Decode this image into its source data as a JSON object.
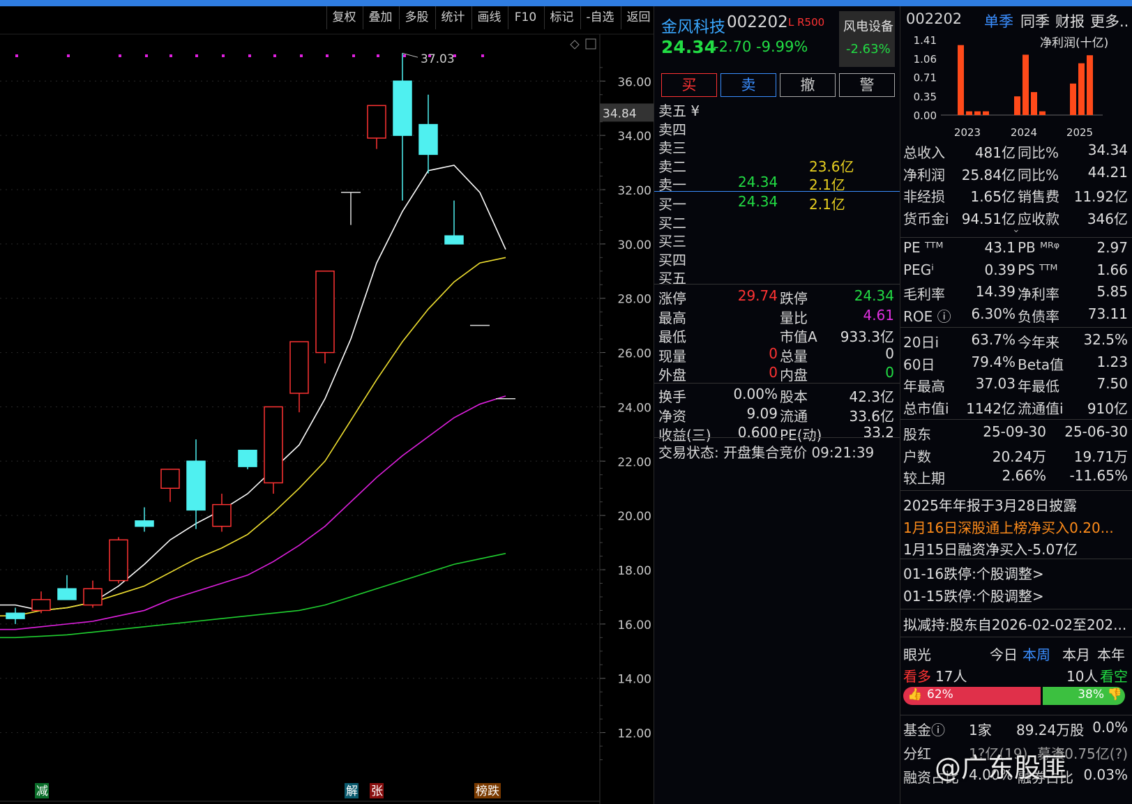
{
  "toolbar": {
    "items": [
      "复权",
      "叠加",
      "多股",
      "统计",
      "画线",
      "F10",
      "标记",
      "-自选",
      "返回"
    ]
  },
  "chart_data": {
    "type": "candlestick",
    "yaxis_ticks": [
      "36.00",
      "34.00",
      "32.00",
      "30.00",
      "28.00",
      "26.00",
      "24.00",
      "22.00",
      "20.00",
      "18.00",
      "16.00",
      "14.00",
      "12.00"
    ],
    "ylim": [
      10.5,
      37.6
    ],
    "current_price_label": "34.84",
    "high_annotation": "37.03",
    "candles": [
      {
        "o": 16.2,
        "h": 16.6,
        "l": 16.0,
        "c": 16.4,
        "d": "down"
      },
      {
        "o": 16.5,
        "h": 17.2,
        "l": 16.4,
        "c": 16.9,
        "d": "up"
      },
      {
        "o": 17.3,
        "h": 17.8,
        "l": 16.9,
        "c": 16.9,
        "d": "down"
      },
      {
        "o": 16.7,
        "h": 17.6,
        "l": 16.6,
        "c": 17.3,
        "d": "up"
      },
      {
        "o": 17.6,
        "h": 19.2,
        "l": 17.5,
        "c": 19.1,
        "d": "up"
      },
      {
        "o": 19.8,
        "h": 20.3,
        "l": 19.4,
        "c": 19.6,
        "d": "down"
      },
      {
        "o": 21.0,
        "h": 21.7,
        "l": 20.5,
        "c": 21.7,
        "d": "up"
      },
      {
        "o": 22.0,
        "h": 22.8,
        "l": 19.5,
        "c": 20.2,
        "d": "down"
      },
      {
        "o": 19.6,
        "h": 20.8,
        "l": 19.4,
        "c": 20.4,
        "d": "up"
      },
      {
        "o": 22.4,
        "h": 22.4,
        "l": 21.7,
        "c": 21.8,
        "d": "down"
      },
      {
        "o": 21.2,
        "h": 24.0,
        "l": 20.8,
        "c": 24.0,
        "d": "up"
      },
      {
        "o": 24.5,
        "h": 26.4,
        "l": 23.8,
        "c": 26.4,
        "d": "up"
      },
      {
        "o": 26.0,
        "h": 29.0,
        "l": 25.6,
        "c": 29.0,
        "d": "up"
      },
      {
        "o": 31.9,
        "h": 31.9,
        "l": 30.7,
        "c": 31.9,
        "d": "doji"
      },
      {
        "o": 33.9,
        "h": 35.1,
        "l": 33.5,
        "c": 35.1,
        "d": "up"
      },
      {
        "o": 36.0,
        "h": 37.03,
        "l": 31.6,
        "c": 34.0,
        "d": "down"
      },
      {
        "o": 34.4,
        "h": 35.5,
        "l": 32.6,
        "c": 33.3,
        "d": "down"
      },
      {
        "o": 30.3,
        "h": 31.6,
        "l": 30.0,
        "c": 30.0,
        "d": "down"
      },
      {
        "o": 27.0,
        "h": 27.0,
        "l": 27.0,
        "c": 27.0,
        "d": "doji"
      },
      {
        "o": 24.3,
        "h": 24.3,
        "l": 24.3,
        "c": 24.3,
        "d": "doji"
      }
    ],
    "series": [
      {
        "name": "",
        "color": "#ffffff",
        "values": [
          16.7,
          16.5,
          16.6,
          16.8,
          17.4,
          18.2,
          19.1,
          19.7,
          20.2,
          20.8,
          21.7,
          22.6,
          24.3,
          26.5,
          29.3,
          31.2,
          32.7,
          32.9,
          31.9,
          29.8
        ]
      },
      {
        "name": "",
        "color": "#f0e030",
        "values": [
          16.3,
          16.5,
          16.6,
          16.8,
          17.1,
          17.4,
          17.9,
          18.4,
          18.8,
          19.3,
          20.1,
          21.0,
          22.0,
          23.5,
          25.0,
          26.4,
          27.6,
          28.6,
          29.3,
          29.5
        ]
      },
      {
        "name": "",
        "color": "#e020e0",
        "values": [
          15.8,
          15.9,
          16.0,
          16.1,
          16.3,
          16.5,
          16.9,
          17.2,
          17.5,
          17.8,
          18.3,
          18.9,
          19.6,
          20.5,
          21.4,
          22.2,
          22.9,
          23.6,
          24.1,
          24.4
        ]
      },
      {
        "name": "",
        "color": "#20d030",
        "values": [
          15.5,
          15.55,
          15.6,
          15.7,
          15.8,
          15.9,
          16.0,
          16.1,
          16.2,
          16.3,
          16.4,
          16.5,
          16.7,
          17.0,
          17.3,
          17.6,
          17.9,
          18.2,
          18.4,
          18.6
        ]
      }
    ],
    "markers": [
      "减",
      "解",
      "张",
      "榜跌"
    ]
  },
  "quote": {
    "name": "金风科技",
    "code": "002202",
    "tags": "L R500",
    "sector": "风电设备",
    "sector_change": "-2.63%",
    "price": "24.34",
    "change": "-2.70",
    "change_pct": "-9.99%",
    "buttons": [
      "买",
      "卖",
      "撤",
      "警"
    ],
    "asks": [
      {
        "label": "卖五 ¥",
        "p": "",
        "v": ""
      },
      {
        "label": "卖四",
        "p": "",
        "v": ""
      },
      {
        "label": "卖三",
        "p": "",
        "v": ""
      },
      {
        "label": "卖二",
        "p": "",
        "v": "23.6亿"
      },
      {
        "label": "卖一",
        "p": "24.34",
        "v": "2.1亿"
      }
    ],
    "bids": [
      {
        "label": "买一",
        "p": "24.34",
        "v": "2.1亿"
      },
      {
        "label": "买二",
        "p": "",
        "v": ""
      },
      {
        "label": "买三",
        "p": "",
        "v": ""
      },
      {
        "label": "买四",
        "p": "",
        "v": ""
      },
      {
        "label": "买五",
        "p": "",
        "v": ""
      }
    ],
    "stats1": [
      {
        "l1": "涨停",
        "v1": "29.74",
        "l2": "跌停",
        "v2": "24.34"
      },
      {
        "l1": "最高",
        "v1": "",
        "l2": "量比",
        "v2": "4.61"
      },
      {
        "l1": "最低",
        "v1": "",
        "l2": "市值A",
        "v2": "933.3亿"
      },
      {
        "l1": "现量",
        "v1": "0",
        "l2": "总量",
        "v2": "0"
      },
      {
        "l1": "外盘",
        "v1": "0",
        "l2": "内盘",
        "v2": "0"
      }
    ],
    "stats2": [
      {
        "l1": "换手",
        "v1": "0.00%",
        "l2": "股本",
        "v2": "42.3亿"
      },
      {
        "l1": "净资",
        "v1": "9.09",
        "l2": "流通",
        "v2": "33.6亿"
      },
      {
        "l1": "收益(三)",
        "v1": "0.600",
        "l2": "PE(动)",
        "v2": "33.2"
      }
    ],
    "status": "交易状态: 开盘集合竞价 09:21:39"
  },
  "fin": {
    "code": "002202",
    "tabs": [
      "单季",
      "同季",
      "财报",
      "更多.."
    ],
    "mini_chart": {
      "title": "净利润(十亿)",
      "yticks": [
        "1.41",
        "1.06",
        "0.71",
        "0.35",
        "0.00"
      ],
      "years": [
        "2023",
        "2024",
        "2025"
      ],
      "values": [
        1.31,
        0.07,
        0.07,
        0.07,
        0.35,
        1.13,
        0.43,
        0.07,
        0.59,
        0.97,
        1.12
      ]
    },
    "rows": [
      {
        "l1": "总收入",
        "v1": "481亿",
        "l2": "同比%",
        "v2": "34.34"
      },
      {
        "l1": "净利润",
        "v1": "25.84亿",
        "l2": "同比%",
        "v2": "44.21"
      },
      {
        "l1": "非经损",
        "v1": "1.65亿",
        "l2": "销售费",
        "v2": "11.92亿"
      },
      {
        "l1": "货币金i",
        "v1": "94.51亿",
        "l2": "应收款",
        "v2": "346亿"
      }
    ],
    "rows2": [
      {
        "l1": "PE ᵀᵀᴹ",
        "v1": "43.1",
        "l2": "PB ᴹᴿᵠ",
        "v2": "2.97"
      },
      {
        "l1": "PEGⁱ",
        "v1": "0.39",
        "l2": "PS ᵀᵀᴹ",
        "v2": "1.66"
      },
      {
        "l1": "毛利率",
        "v1": "14.39",
        "l2": "净利率",
        "v2": "5.85"
      },
      {
        "l1": "ROE ⓘ",
        "v1": "6.30%",
        "l2": "负债率",
        "v2": "73.11"
      }
    ],
    "rows3": [
      {
        "l1": "20日i",
        "v1": "63.7%",
        "l2": "今年来",
        "v2": "32.5%"
      },
      {
        "l1": "60日",
        "v1": "79.4%",
        "l2": "Beta值",
        "v2": "1.23"
      },
      {
        "l1": "年最高",
        "v1": "37.03",
        "l2": "年最低",
        "v2": "7.50"
      },
      {
        "l1": "总市值i",
        "v1": "1142亿",
        "l2": "流通值i",
        "v2": "910亿"
      }
    ],
    "holders": [
      {
        "l": "股东",
        "a": "25-09-30",
        "b": "25-06-30"
      },
      {
        "l": "户数",
        "a": "20.24万",
        "b": "19.71万"
      },
      {
        "l": "较上期",
        "a": "2.66%",
        "b": "-11.65%"
      }
    ],
    "news": [
      "2025年年报于3月28日披露",
      "1月16日深股通上榜净买入0.20...",
      "1月15日融资净买入-5.07亿"
    ],
    "events": [
      "01-16跌停:个股调整>",
      "01-15跌停:个股调整>"
    ],
    "plan": "拟减持:股东自2026-02-02至202...",
    "vision": {
      "title": "眼光",
      "tabs": [
        "今日",
        "本周",
        "本月",
        "本年"
      ],
      "bull_label": "看多",
      "bull_count": "17人",
      "bear_count": "10人",
      "bear_label": "看空",
      "bull_pct": "62%",
      "bear_pct": "38%",
      "bull_frac": 0.62
    },
    "fund": {
      "l": "基金ⓘ",
      "a": "1家",
      "b": "89.24万股",
      "c": "0.0%"
    },
    "dividend": {
      "l": "分红",
      "a": "1?亿(19)",
      "b": "募资",
      "c": "50.75亿(?)"
    },
    "margin": {
      "l1": "融资占比",
      "v1": "4.00%",
      "l2": "融券占比",
      "v2": "0.03%"
    },
    "watermark": "@广东股匪"
  }
}
